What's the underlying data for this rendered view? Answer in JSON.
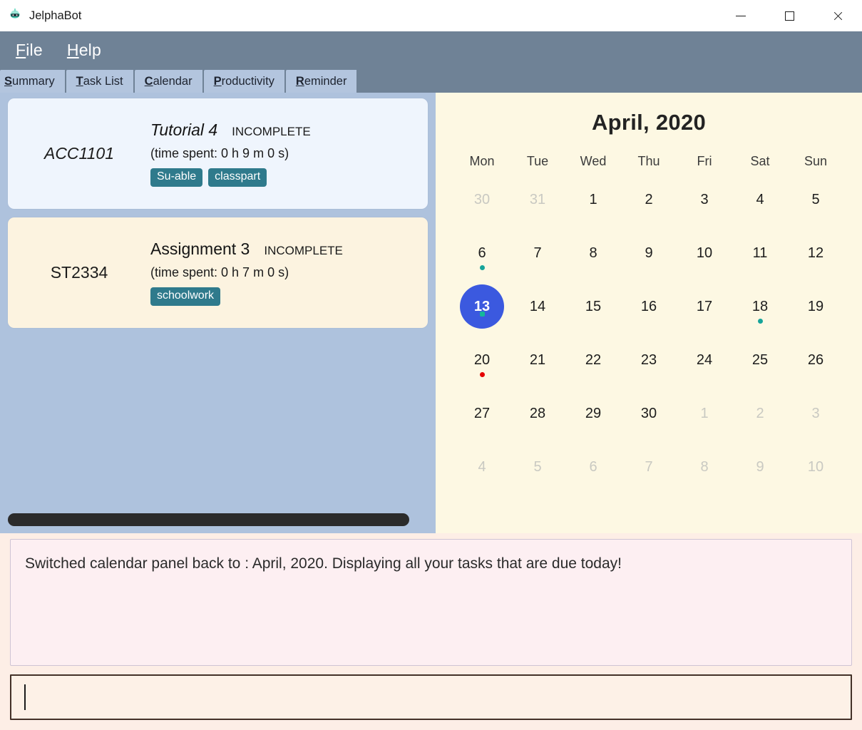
{
  "window": {
    "title": "JelphaBot",
    "icon": "robot-icon",
    "controls": [
      {
        "name": "minimize",
        "glyph": "minimize-icon"
      },
      {
        "name": "maximize",
        "glyph": "maximize-icon"
      },
      {
        "name": "close",
        "glyph": "close-icon"
      }
    ]
  },
  "menubar": {
    "items": [
      {
        "label": "File",
        "mnemonic": "F",
        "rest": "ile"
      },
      {
        "label": "Help",
        "mnemonic": "H",
        "rest": "elp"
      }
    ]
  },
  "tabs": [
    {
      "label": "Summary",
      "mnemonic": "S",
      "rest": "ummary",
      "active": true
    },
    {
      "label": "Task List",
      "mnemonic": "T",
      "rest": "ask List",
      "active": false
    },
    {
      "label": "Calendar",
      "mnemonic": "C",
      "rest": "alendar",
      "active": false
    },
    {
      "label": "Productivity",
      "mnemonic": "P",
      "rest": "roductivity",
      "active": false
    },
    {
      "label": "Reminder",
      "mnemonic": "R",
      "rest": "eminder",
      "active": false
    }
  ],
  "tasks": [
    {
      "module": "ACC1101",
      "name": "Tutorial 4",
      "status": "INCOMPLETE",
      "time_spent": "(time spent: 0 h 9 m 0 s)",
      "tags": [
        "Su-able",
        "classpart"
      ],
      "style": "blue"
    },
    {
      "module": "ST2334",
      "name": "Assignment 3",
      "status": "INCOMPLETE",
      "time_spent": "(time spent: 0 h 7 m 0 s)",
      "tags": [
        "schoolwork"
      ],
      "style": "cream"
    }
  ],
  "calendar": {
    "title": "April, 2020",
    "day_headers": [
      "Mon",
      "Tue",
      "Wed",
      "Thu",
      "Fri",
      "Sat",
      "Sun"
    ],
    "weeks": [
      [
        {
          "n": "30",
          "muted": true
        },
        {
          "n": "31",
          "muted": true
        },
        {
          "n": "1"
        },
        {
          "n": "2"
        },
        {
          "n": "3"
        },
        {
          "n": "4"
        },
        {
          "n": "5"
        }
      ],
      [
        {
          "n": "6",
          "dot": "teal"
        },
        {
          "n": "7"
        },
        {
          "n": "8"
        },
        {
          "n": "9"
        },
        {
          "n": "10"
        },
        {
          "n": "11"
        },
        {
          "n": "12"
        }
      ],
      [
        {
          "n": "13",
          "today": true,
          "dot": "today"
        },
        {
          "n": "14"
        },
        {
          "n": "15"
        },
        {
          "n": "16"
        },
        {
          "n": "17"
        },
        {
          "n": "18",
          "dot": "teal"
        },
        {
          "n": "19"
        }
      ],
      [
        {
          "n": "20",
          "dot": "red"
        },
        {
          "n": "21"
        },
        {
          "n": "22"
        },
        {
          "n": "23"
        },
        {
          "n": "24"
        },
        {
          "n": "25"
        },
        {
          "n": "26"
        }
      ],
      [
        {
          "n": "27"
        },
        {
          "n": "28"
        },
        {
          "n": "29"
        },
        {
          "n": "30"
        },
        {
          "n": "1",
          "muted": true
        },
        {
          "n": "2",
          "muted": true
        },
        {
          "n": "3",
          "muted": true
        }
      ],
      [
        {
          "n": "4",
          "muted": true
        },
        {
          "n": "5",
          "muted": true
        },
        {
          "n": "6",
          "muted": true
        },
        {
          "n": "7",
          "muted": true
        },
        {
          "n": "8",
          "muted": true
        },
        {
          "n": "9",
          "muted": true
        },
        {
          "n": "10",
          "muted": true
        }
      ]
    ]
  },
  "status": {
    "message": "Switched calendar panel back to : April, 2020. Displaying all your tasks that are due today!"
  },
  "command": {
    "value": "",
    "placeholder": ""
  },
  "colors": {
    "menubar": "#6f8296",
    "tab": "#b3c5de",
    "left_pane": "#aec2dd",
    "calendar_pane": "#fdf8e3",
    "card_blue": "#eff5fd",
    "card_cream": "#fcf3e0",
    "tag": "#2f7a8c",
    "today": "#3b59df",
    "dot_teal": "#16a49a",
    "dot_red": "#e50000",
    "status_bg": "#fdeff2",
    "outer_bg": "#fdeee6"
  }
}
